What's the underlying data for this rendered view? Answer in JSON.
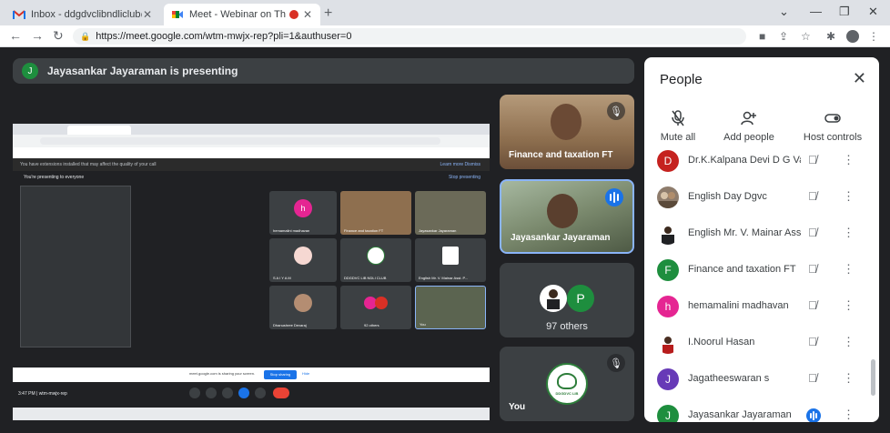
{
  "browser": {
    "tabs": [
      {
        "title": "Inbox - ddgdvclibndliclub@gmai",
        "icon": "gmail-icon"
      },
      {
        "title": "Meet - Webinar on The Art o",
        "icon": "meet-icon",
        "recording": true
      }
    ],
    "url": "https://meet.google.com/wtm-mwjx-rep?pli=1&authuser=0"
  },
  "stage": {
    "presenting_label": "Jayasankar Jayaraman is presenting",
    "presenter_initial": "J",
    "shared": {
      "warning": "You have extensions installed that may affect the quality of your call",
      "warning_actions": "Learn more    Dismiss",
      "presenting_to": "You're presenting to everyone",
      "stop_presenting": "Stop presenting",
      "time": "3:47 PM  |  wtm-mwjx-rep",
      "tiles": [
        {
          "label": "hemamalini madhavan",
          "initial": "h"
        },
        {
          "label": "Finance and taxation FT"
        },
        {
          "label": "Jayasankar Jayaraman"
        },
        {
          "label": "S A I Y A M"
        },
        {
          "label": "DDGDVC LIB NDLI CLUB"
        },
        {
          "label": "English Mr. V. Mainar Asst. P..."
        },
        {
          "label": "Dhanushree Devaraj"
        },
        {
          "label": "92 others"
        },
        {
          "label": "You"
        }
      ],
      "sharebar_text": "meet.google.com is sharing your screen.",
      "stop_sharing": "Stop sharing",
      "hide": "Hide"
    },
    "side_tiles": [
      {
        "name": "Finance and taxation FT",
        "muted": true
      },
      {
        "name": "Jayasankar Jayaraman",
        "speaking": true
      },
      {
        "others_label": "97 others",
        "initial": "P"
      },
      {
        "name": "You",
        "muted": true,
        "logo_text": "DDGDVC LIB"
      }
    ]
  },
  "people": {
    "title": "People",
    "actions": [
      {
        "label": "Mute all",
        "icon": "mic-off-icon"
      },
      {
        "label": "Add people",
        "icon": "person-add-icon"
      },
      {
        "label": "Host controls",
        "icon": "toggle-icon"
      }
    ],
    "participants": [
      {
        "name": "Dr.K.Kalpana Devi D G Vai...",
        "initial": "D",
        "color": "#c5221f",
        "muted": true
      },
      {
        "name": "English Day Dgvc",
        "initial": "",
        "color": "#8e7c6c",
        "muted": true
      },
      {
        "name": "English Mr. V. Mainar Asst...",
        "initial": "",
        "color": "#ffffff",
        "muted": true
      },
      {
        "name": "Finance and taxation FT",
        "initial": "F",
        "color": "#1e8e3e",
        "muted": true
      },
      {
        "name": "hemamalini madhavan",
        "initial": "h",
        "color": "#e52592",
        "muted": true
      },
      {
        "name": "I.Noorul Hasan",
        "initial": "",
        "color": "#ffffff",
        "muted": true
      },
      {
        "name": "Jagatheeswaran s",
        "initial": "J",
        "color": "#673ab7",
        "muted": true
      },
      {
        "name": "Jayasankar Jayaraman",
        "initial": "J",
        "color": "#1e8e3e",
        "speaking": true
      }
    ]
  }
}
